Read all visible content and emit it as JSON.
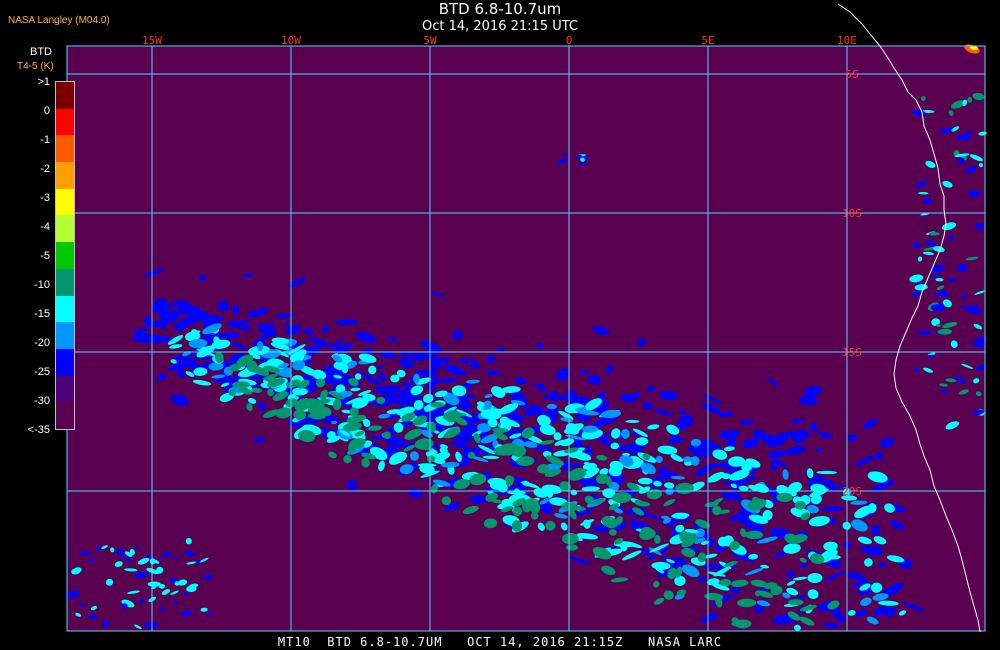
{
  "header": {
    "title": "BTD 6.8-10.7um",
    "subtitle": "Oct 14, 2016 21:15 UTC",
    "credit": "NASA Langley (M04.0)"
  },
  "legend": {
    "title": "BTD",
    "subtitle": "T4-5 (K)",
    "labels": [
      ">1",
      "0",
      "-1",
      "-2",
      "-3",
      "-4",
      "-5",
      "-10",
      "-15",
      "-20",
      "-25",
      "-30",
      "<-35"
    ],
    "colors": [
      "#7a0000",
      "#ff0000",
      "#ff5a00",
      "#ffa000",
      "#ffff00",
      "#b4ff32",
      "#00c800",
      "#00966e",
      "#00ffff",
      "#0096ff",
      "#0000ff",
      "#4b0078",
      "#5a0050"
    ]
  },
  "map": {
    "background": "#5a0050",
    "grid_color": "#50d8ff",
    "lon_labels": [
      "15W",
      "10W",
      "5W",
      "0",
      "5E",
      "10E"
    ],
    "lat_labels": [
      "5S",
      "10S",
      "15S",
      "20S"
    ],
    "lon_label_color": "#ff3030",
    "lat_label_color": "#ff3030"
  },
  "footer": {
    "text": "MT10  BTD 6.8-10.7UM   OCT 14, 2016 21:15Z   NASA LARC"
  }
}
